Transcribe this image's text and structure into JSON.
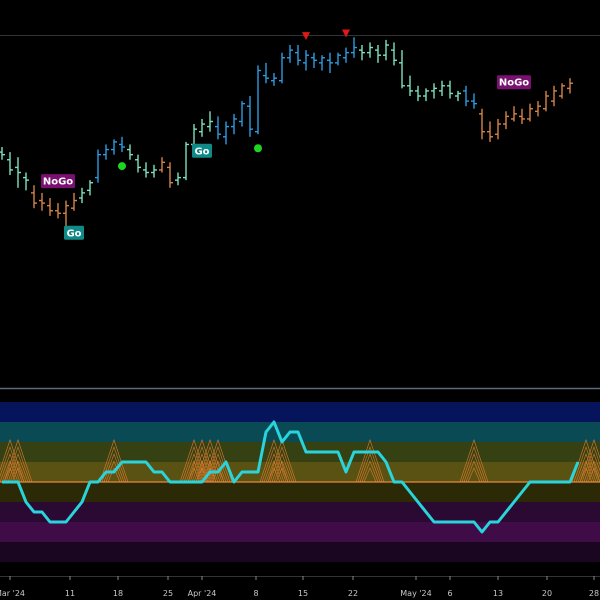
{
  "colors": {
    "background": "#000000",
    "bar_strong_up": "#2e9be0",
    "bar_weak_up": "#7fe0c0",
    "bar_weak_down": "#d4844a",
    "bar_strong_down": "#c060d0",
    "go_dot": "#1ed620",
    "nogo_triangle": "#e01818",
    "go_label_bg": "#0f8a87",
    "nogo_label_bg": "#7a1070",
    "oscillator_line": "#29d4dc",
    "zero_line": "#e8893c",
    "cluster_lines": "#d87a2e"
  },
  "price_labels": [
    {
      "text": "NoGo",
      "kind": "nogo"
    },
    {
      "text": "Go",
      "kind": "go"
    },
    {
      "text": "Go",
      "kind": "go"
    },
    {
      "text": "NoGo",
      "kind": "nogo"
    }
  ],
  "x_axis": {
    "ticks": [
      "Mar '24",
      "11",
      "18",
      "25",
      "Apr '24",
      "8",
      "15",
      "22",
      "May '24",
      "6",
      "13",
      "20",
      "28"
    ]
  },
  "chart_data": [
    {
      "type": "ohlc",
      "name": "",
      "title": "",
      "ylabel": "",
      "xlabel": "",
      "ylim": [
        0,
        100
      ],
      "legend": "none",
      "grid": false,
      "series": [
        {
          "name": "",
          "bars": [
            [
              58,
              60,
              55,
              57,
              "L"
            ],
            [
              55,
              58,
              49,
              51,
              "L"
            ],
            [
              52,
              56,
              44,
              50,
              "L"
            ],
            [
              48,
              50,
              43,
              47,
              "L"
            ],
            [
              42,
              45,
              36,
              38,
              "O"
            ],
            [
              39,
              42,
              35,
              38,
              "O"
            ],
            [
              37,
              40,
              33,
              35,
              "O"
            ],
            [
              35,
              38,
              32,
              34,
              "O"
            ],
            [
              34,
              39,
              29,
              37,
              "O"
            ],
            [
              36,
              42,
              35,
              39,
              "O"
            ],
            [
              40,
              44,
              38,
              42,
              "L"
            ],
            [
              43,
              47,
              41,
              46,
              "L"
            ],
            [
              48,
              59,
              46,
              57,
              "B"
            ],
            [
              57,
              61,
              55,
              59,
              "B"
            ],
            [
              59,
              63,
              57,
              62,
              "B"
            ],
            [
              61,
              64,
              58,
              60,
              "B"
            ],
            [
              59,
              61,
              55,
              57,
              "L"
            ],
            [
              55,
              57,
              50,
              52,
              "L"
            ],
            [
              51,
              54,
              48,
              50,
              "L"
            ],
            [
              50,
              53,
              48,
              51,
              "L"
            ],
            [
              51,
              56,
              50,
              54,
              "O"
            ],
            [
              52,
              54,
              44,
              46,
              "O"
            ],
            [
              47,
              50,
              45,
              48,
              "L"
            ],
            [
              48,
              62,
              47,
              61,
              "L"
            ],
            [
              61,
              69,
              60,
              67,
              "L"
            ],
            [
              66,
              71,
              64,
              69,
              "L"
            ],
            [
              68,
              74,
              66,
              70,
              "L"
            ],
            [
              68,
              72,
              63,
              65,
              "B"
            ],
            [
              64,
              70,
              61,
              68,
              "B"
            ],
            [
              68,
              73,
              65,
              71,
              "B"
            ],
            [
              70,
              78,
              68,
              77,
              "B"
            ],
            [
              76,
              80,
              64,
              67,
              "B"
            ],
            [
              66,
              92,
              65,
              90,
              "B"
            ],
            [
              88,
              93,
              85,
              87,
              "B"
            ],
            [
              86,
              89,
              84,
              87,
              "B"
            ],
            [
              86,
              97,
              85,
              95,
              "B"
            ],
            [
              95,
              100,
              93,
              98,
              "B"
            ],
            [
              97,
              100,
              92,
              94,
              "B"
            ],
            [
              93,
              98,
              90,
              96,
              "B"
            ],
            [
              95,
              97,
              91,
              94,
              "B"
            ],
            [
              93,
              96,
              90,
              95,
              "B"
            ],
            [
              94,
              97,
              89,
              93,
              "B"
            ],
            [
              93,
              97,
              92,
              96,
              "B"
            ],
            [
              95,
              99,
              93,
              97,
              "B"
            ],
            [
              97,
              103,
              95,
              99,
              "B"
            ],
            [
              98,
              100,
              94,
              97,
              "L"
            ],
            [
              97,
              101,
              95,
              99,
              "L"
            ],
            [
              98,
              100,
              93,
              96,
              "L"
            ],
            [
              96,
              102,
              94,
              100,
              "L"
            ],
            [
              98,
              101,
              92,
              94,
              "L"
            ],
            [
              93,
              98,
              83,
              84,
              "L"
            ],
            [
              84,
              88,
              80,
              82,
              "L"
            ],
            [
              82,
              84,
              78,
              80,
              "L"
            ],
            [
              80,
              83,
              78,
              82,
              "L"
            ],
            [
              82,
              85,
              79,
              83,
              "L"
            ],
            [
              82,
              86,
              80,
              84,
              "L"
            ],
            [
              84,
              86,
              79,
              81,
              "L"
            ],
            [
              80,
              82,
              78,
              81,
              "L"
            ],
            [
              82,
              84,
              76,
              78,
              "B"
            ],
            [
              78,
              81,
              75,
              77,
              "B"
            ],
            [
              73,
              75,
              63,
              66,
              "O"
            ],
            [
              66,
              70,
              62,
              64,
              "O"
            ],
            [
              65,
              71,
              63,
              69,
              "O"
            ],
            [
              69,
              74,
              67,
              72,
              "O"
            ],
            [
              71,
              76,
              70,
              73,
              "O"
            ],
            [
              72,
              75,
              69,
              71,
              "O"
            ],
            [
              71,
              77,
              70,
              75,
              "O"
            ],
            [
              74,
              78,
              72,
              76,
              "O"
            ],
            [
              75,
              82,
              74,
              80,
              "O"
            ],
            [
              78,
              84,
              76,
              82,
              "O"
            ],
            [
              80,
              85,
              79,
              84,
              "O"
            ],
            [
              83,
              87,
              81,
              85,
              "O"
            ]
          ]
        }
      ],
      "go_dots": [
        15,
        32
      ],
      "nogo_triangles": [
        38,
        43
      ]
    },
    {
      "type": "line",
      "name": "",
      "title": "",
      "ylim": [
        -4,
        4
      ],
      "zones": [
        {
          "from": 3,
          "to": 4,
          "color": "#06145c"
        },
        {
          "from": 2,
          "to": 3,
          "color": "#0a4a55"
        },
        {
          "from": 1,
          "to": 2,
          "color": "#354013"
        },
        {
          "from": 0,
          "to": 1,
          "color": "#5a5212"
        },
        {
          "from": -1,
          "to": 0,
          "color": "#2c2a06"
        },
        {
          "from": -2,
          "to": -1,
          "color": "#2a0a32"
        },
        {
          "from": -3,
          "to": -2,
          "color": "#3f0c47"
        },
        {
          "from": -4,
          "to": -3,
          "color": "#1a0620"
        }
      ],
      "series": [
        {
          "name": "",
          "values": [
            0,
            0,
            0,
            -1,
            -1.5,
            -1.5,
            -2,
            -2,
            -2,
            -1.5,
            -1,
            0,
            0,
            0.5,
            0.5,
            1,
            1,
            1,
            1,
            0.5,
            0.5,
            0,
            0,
            0,
            0,
            0,
            0.5,
            0.5,
            1,
            0,
            0.5,
            0.5,
            0.5,
            2.5,
            3,
            2,
            2.5,
            2.5,
            1.5,
            1.5,
            1.5,
            1.5,
            1.5,
            0.5,
            1.5,
            1.5,
            1.5,
            1.5,
            1,
            0,
            0,
            -0.5,
            -1,
            -1.5,
            -2,
            -2,
            -2,
            -2,
            -2,
            -2,
            -2.5,
            -2,
            -2,
            -1.5,
            -1,
            -0.5,
            0,
            0,
            0,
            0,
            0,
            0,
            1
          ]
        }
      ],
      "zero_line": 0,
      "cluster_positions": [
        1,
        2,
        14,
        24,
        25,
        26,
        27,
        34,
        35,
        46,
        59,
        73,
        74
      ]
    }
  ]
}
